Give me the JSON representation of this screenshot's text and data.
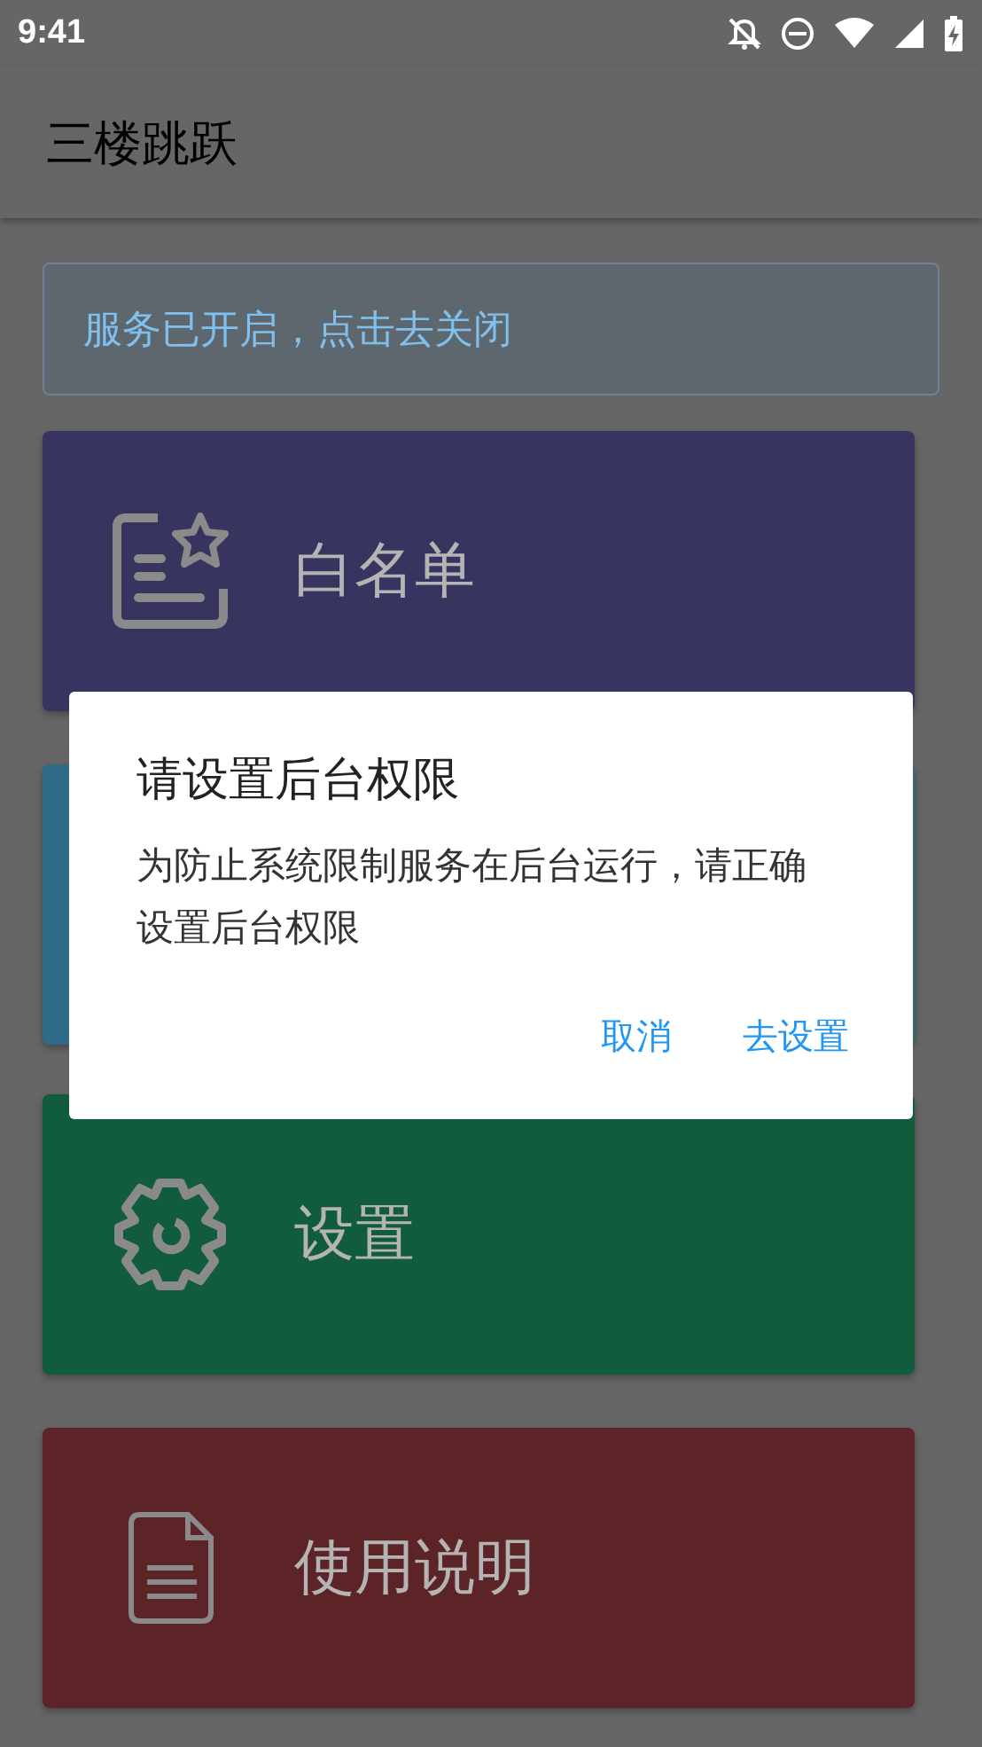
{
  "status_bar": {
    "time": "9:41"
  },
  "app_bar": {
    "title": "三楼跳跃"
  },
  "banner": {
    "text": "服务已开启，点击去关闭"
  },
  "cards": [
    {
      "kind": "whitelist",
      "label": "白名单",
      "color": "#383460"
    },
    {
      "kind": "hidden",
      "color": "#2f6a86"
    },
    {
      "kind": "gear",
      "label": "设置",
      "color": "#115c3d"
    },
    {
      "kind": "document",
      "label": "使用说明",
      "color": "#5c2426"
    }
  ],
  "dialog": {
    "title": "请设置后台权限",
    "message": "为防止系统限制服务在后台运行，请正确设置后台权限",
    "buttons": [
      "取消",
      "去设置"
    ]
  }
}
